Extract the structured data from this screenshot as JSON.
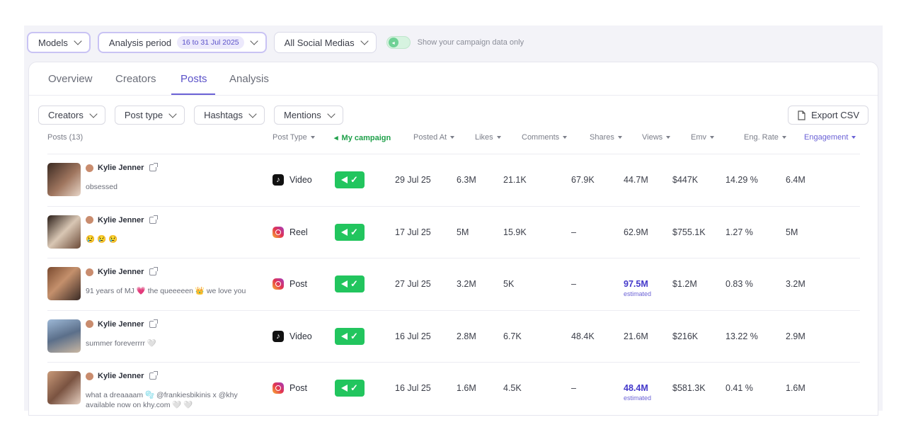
{
  "topbar": {
    "models_label": "Models",
    "period_label": "Analysis period",
    "period_value": "16 to 31 Jul 2025",
    "social_label": "All Social Medias",
    "campaign_toggle_label": "Show your campaign data only"
  },
  "tabs": [
    {
      "label": "Overview"
    },
    {
      "label": "Creators"
    },
    {
      "label": "Posts",
      "active": true
    },
    {
      "label": "Analysis"
    }
  ],
  "filters": {
    "creators": "Creators",
    "post_type": "Post type",
    "hashtags": "Hashtags",
    "mentions": "Mentions",
    "export": "Export CSV"
  },
  "columns": {
    "posts": "Posts (13)",
    "post_type": "Post Type",
    "my_campaign": "My campaign",
    "posted_at": "Posted At",
    "likes": "Likes",
    "comments": "Comments",
    "shares": "Shares",
    "views": "Views",
    "emv": "Emv",
    "eng_rate": "Eng. Rate",
    "engagement": "Engagement"
  },
  "rows": [
    {
      "creator": "Kylie Jenner",
      "caption": "obsessed",
      "type": "Video",
      "platform": "tiktok-icon",
      "posted": "29 Jul 25",
      "likes": "6.3M",
      "comments": "21.1K",
      "shares": "67.9K",
      "views": "44.7M",
      "views_note": "",
      "emv": "$447K",
      "eng_rate": "14.29 %",
      "engagement": "6.4M"
    },
    {
      "creator": "Kylie Jenner",
      "caption": "😢 😢 😢",
      "type": "Reel",
      "platform": "instagram-icon",
      "posted": "17 Jul 25",
      "likes": "5M",
      "comments": "15.9K",
      "shares": "–",
      "views": "62.9M",
      "views_note": "",
      "emv": "$755.1K",
      "eng_rate": "1.27 %",
      "engagement": "5M"
    },
    {
      "creator": "Kylie Jenner",
      "caption": "91 years of MJ 💗 the queeeeen 👑 we love you",
      "type": "Post",
      "platform": "instagram-icon",
      "posted": "27 Jul 25",
      "likes": "3.2M",
      "comments": "5K",
      "shares": "–",
      "views": "97.5M",
      "views_note": "estimated",
      "emv": "$1.2M",
      "eng_rate": "0.83 %",
      "engagement": "3.2M"
    },
    {
      "creator": "Kylie Jenner",
      "caption": "summer foreverrrr 🤍",
      "type": "Video",
      "platform": "tiktok-icon",
      "posted": "16 Jul 25",
      "likes": "2.8M",
      "comments": "6.7K",
      "shares": "48.4K",
      "views": "21.6M",
      "views_note": "",
      "emv": "$216K",
      "eng_rate": "13.22 %",
      "engagement": "2.9M"
    },
    {
      "creator": "Kylie Jenner",
      "caption": "what a dreaaaam 🫧 @frankiesbikinis x @khy available now on khy.com 🤍 🤍",
      "type": "Post",
      "platform": "instagram-icon",
      "posted": "16 Jul 25",
      "likes": "1.6M",
      "comments": "4.5K",
      "shares": "–",
      "views": "48.4M",
      "views_note": "estimated",
      "emv": "$581.3K",
      "eng_rate": "0.41 %",
      "engagement": "1.6M"
    }
  ],
  "colors": {
    "accent": "#5b52c9",
    "campaign_green": "#22c55e"
  }
}
